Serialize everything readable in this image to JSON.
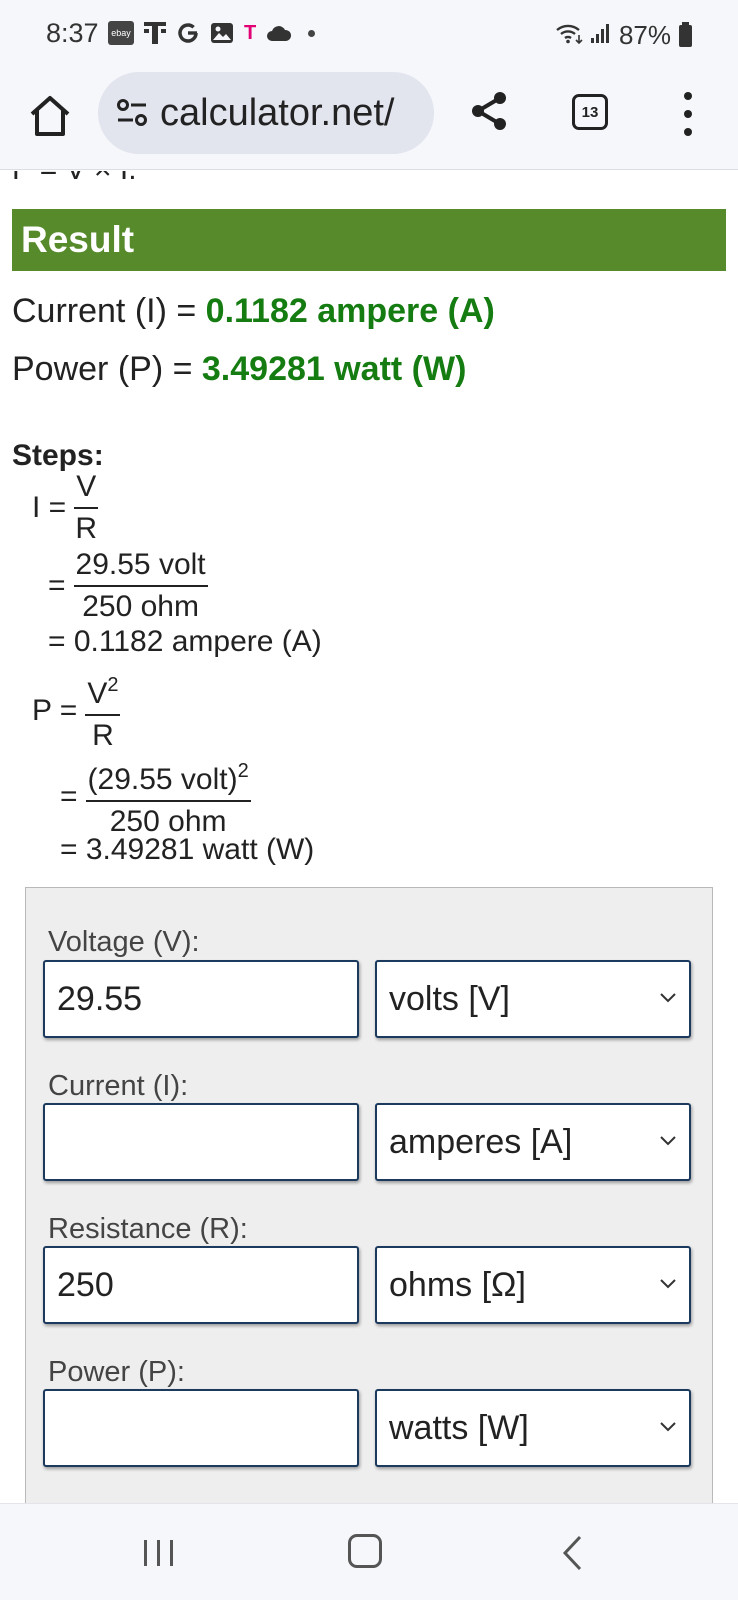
{
  "status_bar": {
    "time": "8:37",
    "ebay_label": "ebay",
    "tmobile_label": "T",
    "battery": "87%"
  },
  "browser": {
    "url": "calculator.net/",
    "tab_count": "13"
  },
  "page": {
    "cutoff_text": "P = V × I.",
    "result_title": "Result",
    "current_label": "Current (I) = ",
    "current_value": "0.1182 ampere (A)",
    "power_label": "Power (P) = ",
    "power_value": "3.49281 watt (W)",
    "steps_title": "Steps:",
    "steps": {
      "i_lhs": "I =",
      "i_num": "V",
      "i_den": "R",
      "i_sub_eq": "=",
      "i_sub_num": "29.55 volt",
      "i_sub_den": "250 ohm",
      "i_result": "= 0.1182 ampere (A)",
      "p_lhs": "P =",
      "p_num": "V",
      "p_num_exp": "2",
      "p_den": "R",
      "p_sub_eq": "=",
      "p_sub_num": "(29.55 volt)",
      "p_sub_num_exp": "2",
      "p_sub_den": "250 ohm",
      "p_result": "= 3.49281 watt (W)"
    }
  },
  "form": {
    "voltage": {
      "label": "Voltage (V):",
      "value": "29.55",
      "unit": "volts [V]"
    },
    "current": {
      "label": "Current (I):",
      "value": "",
      "unit": "amperes [A]"
    },
    "resistance": {
      "label": "Resistance (R):",
      "value": "250",
      "unit": "ohms [Ω]"
    },
    "power": {
      "label": "Power (P):",
      "value": "",
      "unit": "watts [W]"
    }
  },
  "colors": {
    "result_header_bg": "#568a2b",
    "result_value": "#157c11",
    "input_border": "#1c3a5e"
  },
  "icons": [
    "home-icon",
    "site-settings-icon",
    "share-icon",
    "tabs-icon",
    "more-menu-icon",
    "chevron-down-icon",
    "recents-icon",
    "home-nav-icon",
    "back-icon"
  ]
}
